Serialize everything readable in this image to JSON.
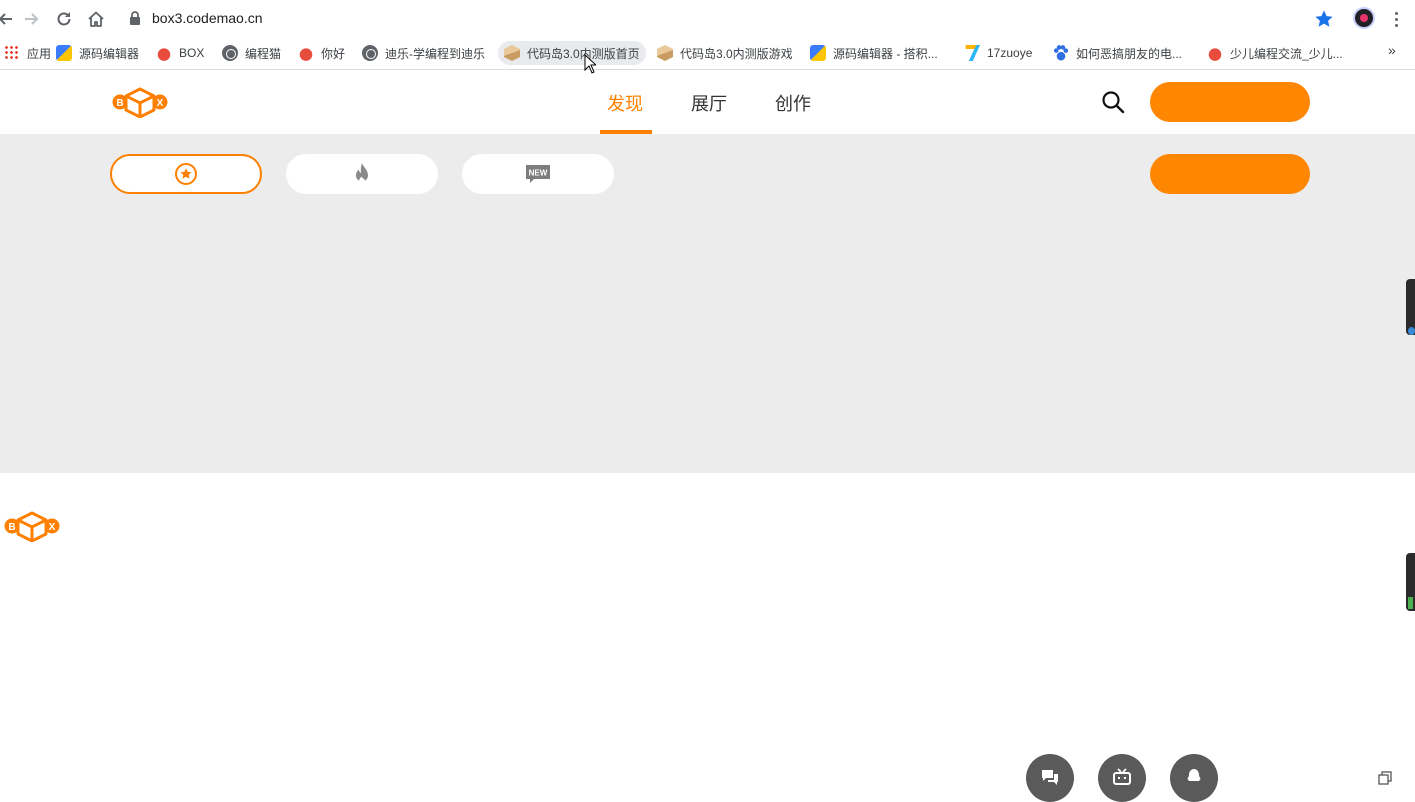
{
  "browser": {
    "url": "box3.codemao.cn",
    "bookmarks": [
      {
        "label": "应用",
        "icon": "apps-grid-icon"
      },
      {
        "label": "源码编辑器",
        "icon": "code-editor-icon"
      },
      {
        "label": "BOX",
        "icon": "codemao-cat-icon"
      },
      {
        "label": "编程猫",
        "icon": "globe-icon"
      },
      {
        "label": "你好",
        "icon": "codemao-cat-icon"
      },
      {
        "label": "迪乐-学编程到迪乐",
        "icon": "globe-icon"
      },
      {
        "label": "代码岛3.0内测版首页",
        "icon": "box-cube-icon"
      },
      {
        "label": "代码岛3.0内测版游戏",
        "icon": "box-cube-icon"
      },
      {
        "label": "源码编辑器 - 搭积...",
        "icon": "code-editor-icon"
      },
      {
        "label": "17zuoye",
        "icon": "17zuoye-icon"
      },
      {
        "label": "如何恶搞朋友的电...",
        "icon": "baidu-paw-icon"
      },
      {
        "label": "少儿编程交流_少儿...",
        "icon": "codemao-cat-icon"
      }
    ],
    "more_label": "»"
  },
  "header": {
    "logo_letters": {
      "left": "B",
      "right": "X"
    },
    "nav": [
      {
        "label": "发现",
        "active": true
      },
      {
        "label": "展厅",
        "active": false
      },
      {
        "label": "创作",
        "active": false
      }
    ]
  },
  "filters": [
    {
      "icon": "star-badge-icon",
      "active": true
    },
    {
      "icon": "flame-icon",
      "active": false
    },
    {
      "icon": "new-badge-icon",
      "badge_text": "NEW",
      "active": false
    }
  ],
  "footer": {
    "social": [
      "chat-icon",
      "bilibili-tv-icon",
      "qq-penguin-icon"
    ]
  },
  "colors": {
    "accent": "#ff8000",
    "button": "#ff8600",
    "band": "#ececec"
  }
}
